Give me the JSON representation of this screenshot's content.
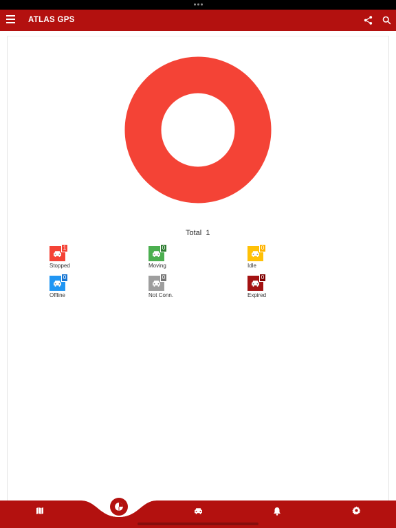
{
  "app": {
    "title": "ATLAS GPS"
  },
  "header": {
    "menu_icon": "hamburger-menu-icon",
    "actions": [
      "share-icon",
      "search-icon"
    ]
  },
  "summary": {
    "total_label": "Total",
    "total_value": "1",
    "donut_color": "#f44336"
  },
  "statuses": [
    {
      "label": "Stopped",
      "count": "1",
      "color": "#f44336",
      "badge_color": "#f44336",
      "icon": "car-icon"
    },
    {
      "label": "Moving",
      "count": "0",
      "color": "#4caf50",
      "badge_color": "#2e7d32",
      "icon": "car-icon"
    },
    {
      "label": "Idle",
      "count": "0",
      "color": "#ffc107",
      "badge_color": "#ffb300",
      "icon": "car-icon"
    },
    {
      "label": "Offline",
      "count": "0",
      "color": "#2196f3",
      "badge_color": "#1976d2",
      "icon": "car-icon"
    },
    {
      "label": "Not Conn.",
      "count": "0",
      "color": "#9e9e9e",
      "badge_color": "#757575",
      "icon": "car-icon"
    },
    {
      "label": "Expired",
      "count": "0",
      "color": "#a31212",
      "badge_color": "#7f0000",
      "icon": "car-icon"
    }
  ],
  "bottom_nav": [
    {
      "name": "map",
      "icon": "map-icon"
    },
    {
      "name": "dashboard",
      "icon": "pie-chart-icon",
      "active": true
    },
    {
      "name": "vehicles",
      "icon": "car-icon"
    },
    {
      "name": "alerts",
      "icon": "bell-icon"
    },
    {
      "name": "settings",
      "icon": "gear-icon"
    }
  ],
  "colors": {
    "brand": "#b3110f",
    "accent": "#f44336"
  }
}
